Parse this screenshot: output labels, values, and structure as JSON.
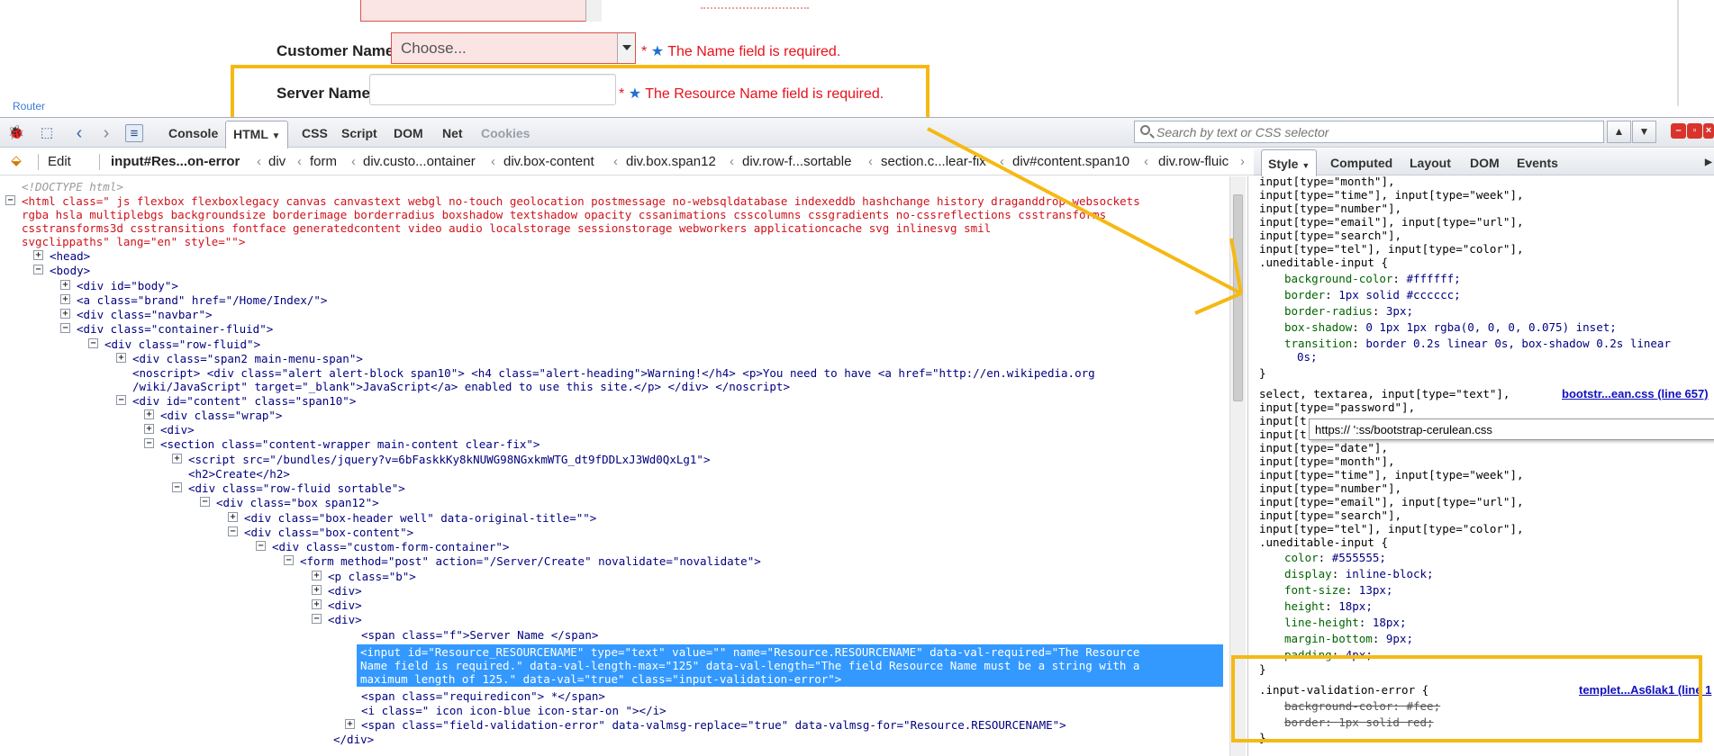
{
  "webpage": {
    "customer_label": "Customer Name",
    "customer_select_value": "Choose...",
    "customer_required_mark": "*",
    "customer_error": "The Name field is required.",
    "server_label": "Server Name",
    "server_input_value": "",
    "server_required_mark": "*",
    "server_error": "The Resource Name field is required.",
    "partial_link": "Router"
  },
  "toolbar": {
    "tabs": [
      "Console",
      "HTML",
      "CSS",
      "Script",
      "DOM",
      "Net",
      "Cookies"
    ],
    "active_tab": "HTML",
    "edit_label": "Edit",
    "search_placeholder": "Search by text or CSS selector"
  },
  "breadcrumbs": [
    "input#Res...on-error",
    "div",
    "form",
    "div.custo...ontainer",
    "div.box-content",
    "div.box.span12",
    "div.row-f...sortable",
    "section.c...lear-fix",
    "div#content.span10",
    "div.row-fluic"
  ],
  "side_tabs": [
    "Style",
    "Computed",
    "Layout",
    "DOM",
    "Events"
  ],
  "html_tree": {
    "doctype": "<!DOCTYPE html>",
    "html_open_1": "<html class=\" js flexbox flexboxlegacy canvas canvastext webgl no-touch geolocation postmessage no-websqldatabase indexeddb hashchange history draganddrop websockets",
    "html_open_2": "rgba hsla multiplebgs backgroundsize borderimage borderradius boxshadow textshadow opacity cssanimations csscolumns cssgradients no-cssreflections csstransforms",
    "html_open_3": "csstransforms3d csstransitions fontface generatedcontent video audio localstorage sessionstorage webworkers applicationcache svg inlinesvg smil",
    "html_open_4": "svgclippaths\" lang=\"en\" style=\"\">",
    "head": "<head>",
    "body": "<body>",
    "div_body": "<div id=\"body\">",
    "a_brand": "<a class=\"brand\" href=\"/Home/Index/\">",
    "div_navbar": "<div class=\"navbar\">",
    "div_container": "<div class=\"container-fluid\">",
    "div_rowfluid": "<div class=\"row-fluid\">",
    "div_span2": "<div class=\"span2 main-menu-span\">",
    "noscript_1": "<noscript> <div class=\"alert alert-block span10\"> <h4 class=\"alert-heading\">Warning!</h4> <p>You need to have <a href=\"http://en.wikipedia.org",
    "noscript_2": "/wiki/JavaScript\" target=\"_blank\">JavaScript</a> enabled to use this site.</p> </div> </noscript>",
    "div_content": "<div id=\"content\" class=\"span10\">",
    "div_wrap": "<div class=\"wrap\">",
    "div_plain": "<div>",
    "section": "<section class=\"content-wrapper main-content clear-fix\">",
    "script": "<script src=\"/bundles/jquery?v=6bFaskkKy8kNUWG98NGxkmWTG_dt9fDDLxJ3Wd0QxLg1\">",
    "h2": "<h2>Create</h2>",
    "div_sortable": "<div class=\"row-fluid sortable\">",
    "div_box": "<div class=\"box span12\">",
    "div_boxheader": "<div class=\"box-header well\" data-original-title=\"\">",
    "div_boxcontent": "<div class=\"box-content\">",
    "div_customform": "<div class=\"custom-form-container\">",
    "form": "<form method=\"post\" action=\"/Server/Create\" novalidate=\"novalidate\">",
    "p_b": "<p class=\"b\">",
    "div_1": "<div>",
    "div_2": "<div>",
    "div_3": "<div>",
    "span_f": "<span class=\"f\">Server Name </span>",
    "input_1": "<input id=\"Resource_RESOURCENAME\" type=\"text\" value=\"\" name=\"Resource.RESOURCENAME\" data-val-required=\"The Resource",
    "input_2": "Name field is required.\" data-val-length-max=\"125\" data-val-length=\"The field Resource Name must be a string with a",
    "input_3": "maximum length of 125.\" data-val=\"true\" class=\"input-validation-error\">",
    "span_req": "<span class=\"requiredicon\"> *</span>",
    "i_icon": "<i class=\" icon icon-blue icon-star-on \"></i>",
    "span_fve": "<span class=\"field-validation-error\" data-valmsg-replace=\"true\" data-valmsg-for=\"Resource.RESOURCENAME\">",
    "div_close": "</div>"
  },
  "style_pane": {
    "top_lines": [
      "input[type=\"month\"],",
      "input[type=\"time\"], input[type=\"week\"],",
      "input[type=\"number\"],",
      "input[type=\"email\"], input[type=\"url\"],",
      "input[type=\"search\"],",
      "input[type=\"tel\"], input[type=\"color\"],",
      ".uneditable-input {"
    ],
    "rule1_props": [
      {
        "p": "background-color",
        "v": "#ffffff;"
      },
      {
        "p": "border",
        "v": "1px solid #cccccc;"
      },
      {
        "p": "border-radius",
        "v": "3px;"
      },
      {
        "p": "box-shadow",
        "v": "0 1px 1px rgba(0, 0, 0, 0.075) inset;"
      },
      {
        "p": "transition",
        "v": "border 0.2s linear 0s, box-shadow 0.2s linear"
      }
    ],
    "rule1_wrap": "0s;",
    "close_brace": "}",
    "rule2_head": "select, textarea, input[type=\"text\"],",
    "rule2_link": "bootstr...ean.css (line 657)",
    "rule2_selectors": [
      "input[type=\"password\"],",
      "input[t",
      "input[t",
      "input[type=\"date\"],",
      "input[type=\"month\"],",
      "input[type=\"time\"], input[type=\"week\"],",
      "input[type=\"number\"],",
      "input[type=\"email\"], input[type=\"url\"],",
      "input[type=\"search\"],",
      "input[type=\"tel\"], input[type=\"color\"],",
      ".uneditable-input {"
    ],
    "rule2_props": [
      {
        "p": "color",
        "v": "#555555;"
      },
      {
        "p": "display",
        "v": "inline-block;"
      },
      {
        "p": "font-size",
        "v": "13px;"
      },
      {
        "p": "height",
        "v": "18px;"
      },
      {
        "p": "line-height",
        "v": "18px;"
      },
      {
        "p": "margin-bottom",
        "v": "9px;"
      },
      {
        "p": "padding",
        "v": "4px;"
      }
    ],
    "rule3_head": ".input-validation-error {",
    "rule3_link": "templet...As6lak1 (line 1",
    "rule3_props": [
      {
        "p": "background-color",
        "v": "#fee;"
      },
      {
        "p": "border",
        "v": "1px solid red;"
      }
    ],
    "tooltip": "https://                                              ':ss/bootstrap-cerulean.css"
  },
  "colors": {
    "highlight_yellow": "#f5b914",
    "selection_blue": "#3399ff",
    "error_red": "#e8101a"
  }
}
